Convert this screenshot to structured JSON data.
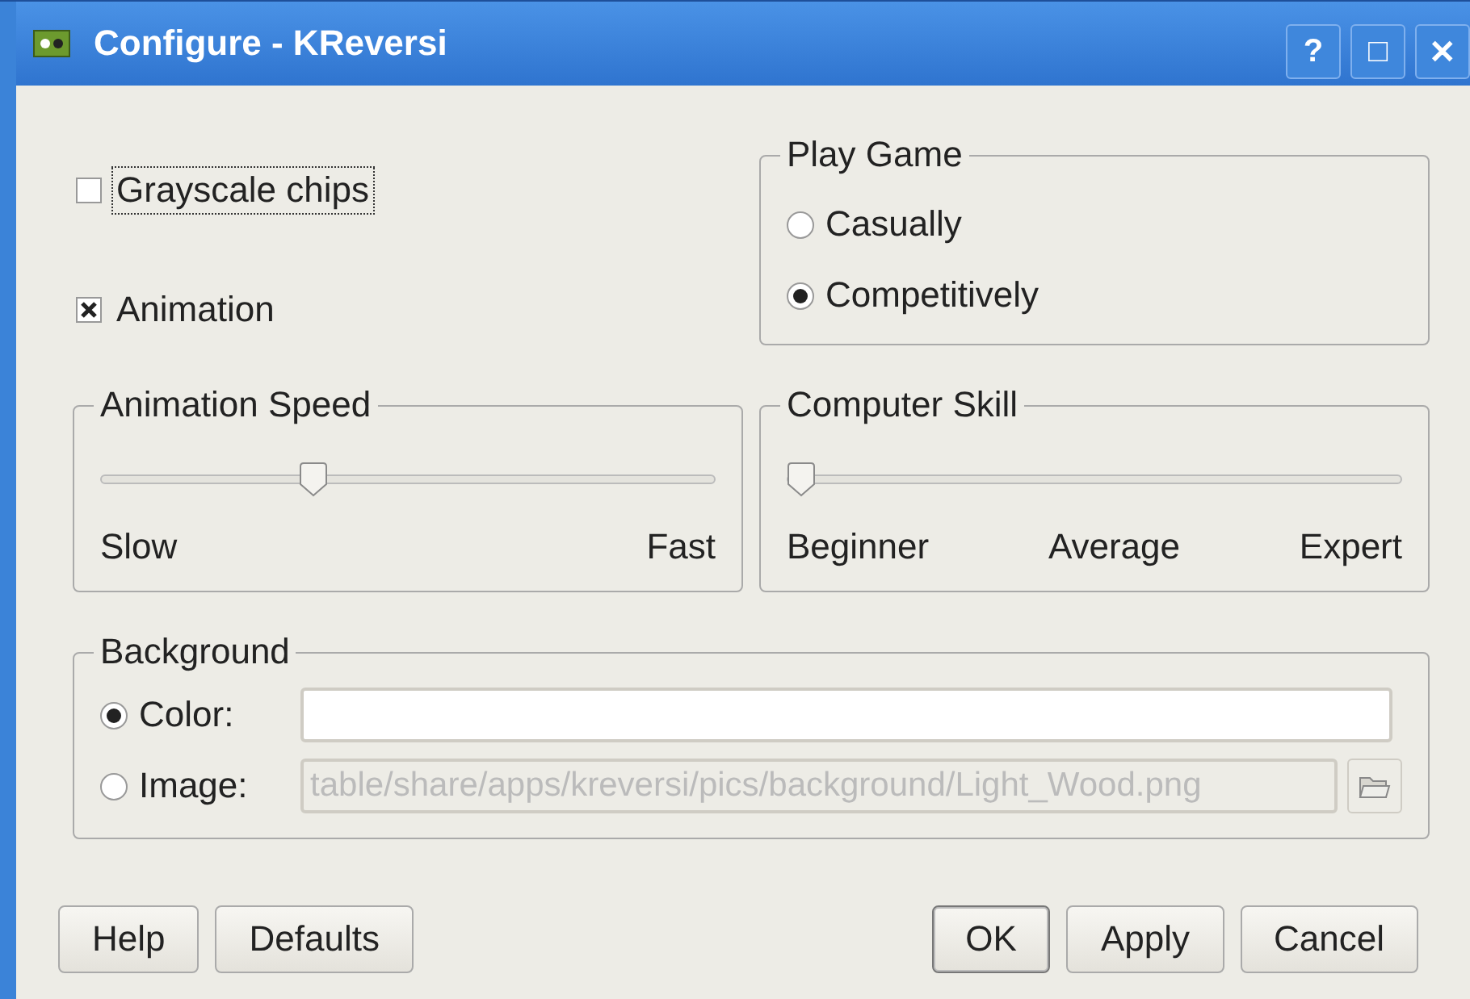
{
  "window": {
    "title": "Configure - KReversi",
    "buttons": [
      "?",
      "□",
      "✕"
    ]
  },
  "options": [
    {
      "label": "Grayscale chips",
      "checked": false,
      "focused": true
    },
    {
      "label": "Animation",
      "checked": true,
      "focused": false
    }
  ],
  "play_game": {
    "title": "Play Game",
    "options": [
      {
        "label": "Casually",
        "selected": false
      },
      {
        "label": "Competitively",
        "selected": true
      }
    ]
  },
  "animation_speed": {
    "title": "Animation Speed",
    "level": 0.34,
    "labels": [
      "Slow",
      "Fast"
    ]
  },
  "computer_skill": {
    "title": "Computer Skill",
    "level": 0,
    "labels": [
      "Beginner",
      "Average",
      "Expert"
    ]
  },
  "background": {
    "title": "Background",
    "options": [
      {
        "label": "Color:",
        "selected": true,
        "kind": "color"
      },
      {
        "label": "Image:",
        "selected": false,
        "kind": "image",
        "value": "table/share/apps/kreversi/pics/background/Light_Wood.png"
      }
    ]
  },
  "buttons_left": [
    "Help",
    "Defaults"
  ],
  "buttons_right": [
    {
      "label": "OK",
      "focused": true
    },
    {
      "label": "Apply",
      "focused": false
    },
    {
      "label": "Cancel",
      "focused": false
    }
  ]
}
